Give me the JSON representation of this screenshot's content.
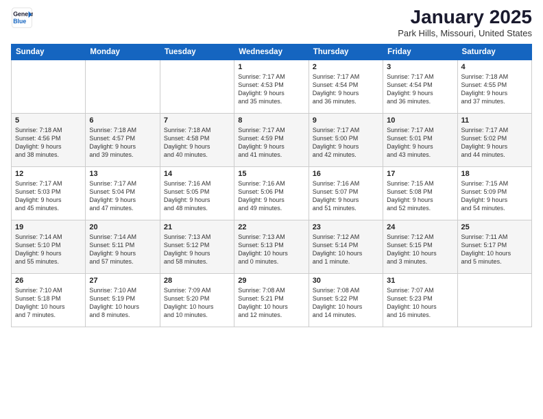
{
  "header": {
    "logo_line1": "General",
    "logo_line2": "Blue",
    "month": "January 2025",
    "location": "Park Hills, Missouri, United States"
  },
  "weekdays": [
    "Sunday",
    "Monday",
    "Tuesday",
    "Wednesday",
    "Thursday",
    "Friday",
    "Saturday"
  ],
  "weeks": [
    [
      {
        "day": "",
        "info": ""
      },
      {
        "day": "",
        "info": ""
      },
      {
        "day": "",
        "info": ""
      },
      {
        "day": "1",
        "info": "Sunrise: 7:17 AM\nSunset: 4:53 PM\nDaylight: 9 hours\nand 35 minutes."
      },
      {
        "day": "2",
        "info": "Sunrise: 7:17 AM\nSunset: 4:54 PM\nDaylight: 9 hours\nand 36 minutes."
      },
      {
        "day": "3",
        "info": "Sunrise: 7:17 AM\nSunset: 4:54 PM\nDaylight: 9 hours\nand 36 minutes."
      },
      {
        "day": "4",
        "info": "Sunrise: 7:18 AM\nSunset: 4:55 PM\nDaylight: 9 hours\nand 37 minutes."
      }
    ],
    [
      {
        "day": "5",
        "info": "Sunrise: 7:18 AM\nSunset: 4:56 PM\nDaylight: 9 hours\nand 38 minutes."
      },
      {
        "day": "6",
        "info": "Sunrise: 7:18 AM\nSunset: 4:57 PM\nDaylight: 9 hours\nand 39 minutes."
      },
      {
        "day": "7",
        "info": "Sunrise: 7:18 AM\nSunset: 4:58 PM\nDaylight: 9 hours\nand 40 minutes."
      },
      {
        "day": "8",
        "info": "Sunrise: 7:17 AM\nSunset: 4:59 PM\nDaylight: 9 hours\nand 41 minutes."
      },
      {
        "day": "9",
        "info": "Sunrise: 7:17 AM\nSunset: 5:00 PM\nDaylight: 9 hours\nand 42 minutes."
      },
      {
        "day": "10",
        "info": "Sunrise: 7:17 AM\nSunset: 5:01 PM\nDaylight: 9 hours\nand 43 minutes."
      },
      {
        "day": "11",
        "info": "Sunrise: 7:17 AM\nSunset: 5:02 PM\nDaylight: 9 hours\nand 44 minutes."
      }
    ],
    [
      {
        "day": "12",
        "info": "Sunrise: 7:17 AM\nSunset: 5:03 PM\nDaylight: 9 hours\nand 45 minutes."
      },
      {
        "day": "13",
        "info": "Sunrise: 7:17 AM\nSunset: 5:04 PM\nDaylight: 9 hours\nand 47 minutes."
      },
      {
        "day": "14",
        "info": "Sunrise: 7:16 AM\nSunset: 5:05 PM\nDaylight: 9 hours\nand 48 minutes."
      },
      {
        "day": "15",
        "info": "Sunrise: 7:16 AM\nSunset: 5:06 PM\nDaylight: 9 hours\nand 49 minutes."
      },
      {
        "day": "16",
        "info": "Sunrise: 7:16 AM\nSunset: 5:07 PM\nDaylight: 9 hours\nand 51 minutes."
      },
      {
        "day": "17",
        "info": "Sunrise: 7:15 AM\nSunset: 5:08 PM\nDaylight: 9 hours\nand 52 minutes."
      },
      {
        "day": "18",
        "info": "Sunrise: 7:15 AM\nSunset: 5:09 PM\nDaylight: 9 hours\nand 54 minutes."
      }
    ],
    [
      {
        "day": "19",
        "info": "Sunrise: 7:14 AM\nSunset: 5:10 PM\nDaylight: 9 hours\nand 55 minutes."
      },
      {
        "day": "20",
        "info": "Sunrise: 7:14 AM\nSunset: 5:11 PM\nDaylight: 9 hours\nand 57 minutes."
      },
      {
        "day": "21",
        "info": "Sunrise: 7:13 AM\nSunset: 5:12 PM\nDaylight: 9 hours\nand 58 minutes."
      },
      {
        "day": "22",
        "info": "Sunrise: 7:13 AM\nSunset: 5:13 PM\nDaylight: 10 hours\nand 0 minutes."
      },
      {
        "day": "23",
        "info": "Sunrise: 7:12 AM\nSunset: 5:14 PM\nDaylight: 10 hours\nand 1 minute."
      },
      {
        "day": "24",
        "info": "Sunrise: 7:12 AM\nSunset: 5:15 PM\nDaylight: 10 hours\nand 3 minutes."
      },
      {
        "day": "25",
        "info": "Sunrise: 7:11 AM\nSunset: 5:17 PM\nDaylight: 10 hours\nand 5 minutes."
      }
    ],
    [
      {
        "day": "26",
        "info": "Sunrise: 7:10 AM\nSunset: 5:18 PM\nDaylight: 10 hours\nand 7 minutes."
      },
      {
        "day": "27",
        "info": "Sunrise: 7:10 AM\nSunset: 5:19 PM\nDaylight: 10 hours\nand 8 minutes."
      },
      {
        "day": "28",
        "info": "Sunrise: 7:09 AM\nSunset: 5:20 PM\nDaylight: 10 hours\nand 10 minutes."
      },
      {
        "day": "29",
        "info": "Sunrise: 7:08 AM\nSunset: 5:21 PM\nDaylight: 10 hours\nand 12 minutes."
      },
      {
        "day": "30",
        "info": "Sunrise: 7:08 AM\nSunset: 5:22 PM\nDaylight: 10 hours\nand 14 minutes."
      },
      {
        "day": "31",
        "info": "Sunrise: 7:07 AM\nSunset: 5:23 PM\nDaylight: 10 hours\nand 16 minutes."
      },
      {
        "day": "",
        "info": ""
      }
    ]
  ]
}
